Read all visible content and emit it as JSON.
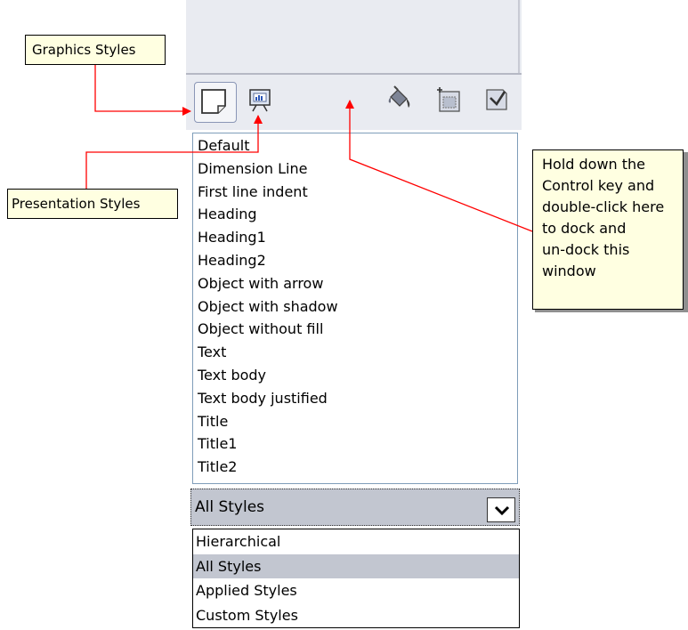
{
  "toolbar": {
    "graphics_styles_icon": "graphics-styles-icon",
    "presentation_styles_icon": "presentation-styles-icon",
    "fill_format_mode_icon": "paint-bucket-icon",
    "new_style_icon": "new-style-from-selection-icon",
    "update_style_icon": "update-style-icon"
  },
  "style_list": {
    "items": [
      "Default",
      "Dimension Line",
      "First line indent",
      "Heading",
      "Heading1",
      "Heading2",
      "Object with arrow",
      "Object with shadow",
      "Object without fill",
      "Text",
      "Text body",
      "Text body justified",
      "Title",
      "Title1",
      "Title2"
    ]
  },
  "filter": {
    "selected": "All Styles",
    "options": [
      "Hierarchical",
      "All Styles",
      "Applied Styles",
      "Custom Styles"
    ],
    "selected_index": 1
  },
  "callouts": {
    "graphics": "Graphics Styles",
    "presentation": "Presentation Styles",
    "dock_lines": [
      "Hold down the",
      "Control key and",
      "double-click here",
      "to dock and",
      "un-dock this",
      "window"
    ]
  },
  "colors": {
    "panel_background": "#e9ebf1",
    "selection": "#c2c6d0",
    "callout_background": "#ffffe1",
    "arrow": "#ff0000",
    "list_border": "#7f9db9"
  }
}
